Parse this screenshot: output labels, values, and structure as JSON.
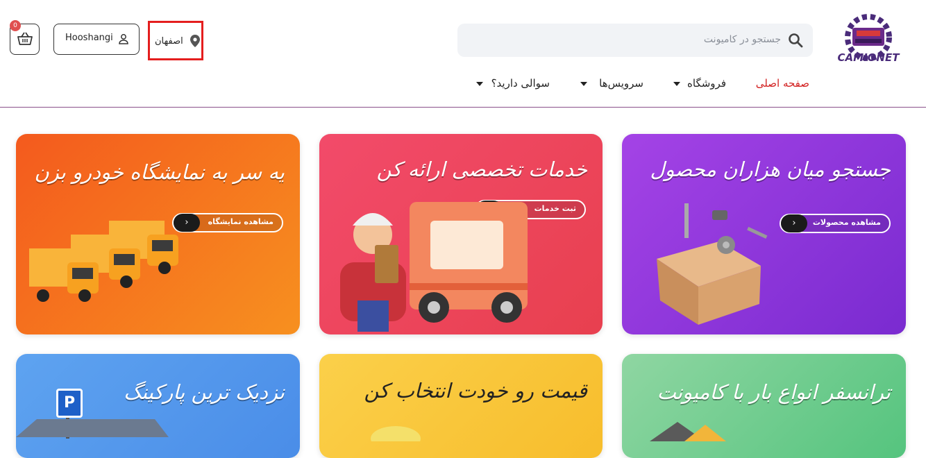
{
  "brand": {
    "logo_text": "CAMIONET"
  },
  "search": {
    "placeholder": "جستجو در کامیونت"
  },
  "location": {
    "label": "اصفهان"
  },
  "user": {
    "name": "Hooshangi"
  },
  "cart": {
    "count": "0"
  },
  "nav": [
    {
      "label": "صفحه اصلی",
      "active": true
    },
    {
      "label": "فروشگاه",
      "dropdown": true
    },
    {
      "label": "سرویس‌ها",
      "dropdown": true
    },
    {
      "label": "سوالی دارید؟",
      "dropdown": true
    }
  ],
  "colors": {
    "active_nav": "#d21f1f",
    "highlight_border": "#e41e1e",
    "divider": "#8a4f8a"
  },
  "cards": [
    {
      "title": "جستجو میان هزاران محصول",
      "button": "مشاهده محصولات",
      "color": "#9b3be0"
    },
    {
      "title": "خدمات تخصصی ارائه کن",
      "button": "ثبت خدمات",
      "color": "#ef4a6a"
    },
    {
      "title": "یه سر به نمایشگاه خودرو بزن",
      "button": "مشاهده نمایشگاه",
      "color": "#f56a1f"
    },
    {
      "title": "ترانسفر انواع بار با کامیونت",
      "color": "#6fd08f"
    },
    {
      "title": "قیمت رو خودت انتخاب کن",
      "color": "#f8c63c"
    },
    {
      "title": "نزدیک ترین پارکینگ",
      "color": "#5d9ff0"
    }
  ]
}
